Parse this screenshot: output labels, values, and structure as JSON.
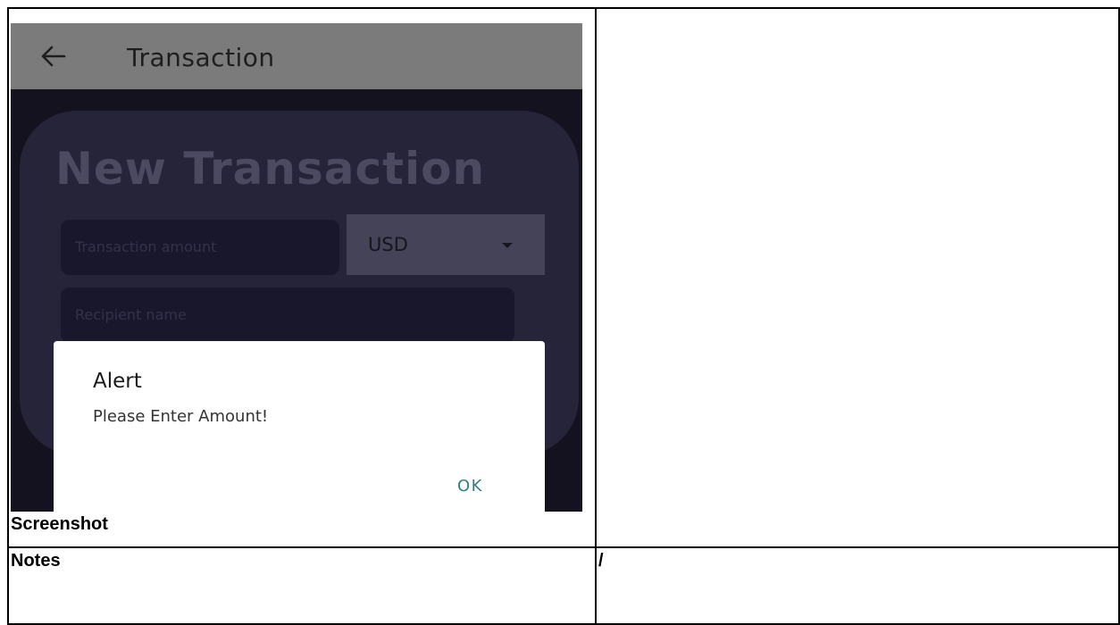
{
  "document": {
    "screenshot_label": "Screenshot",
    "notes_label": "Notes",
    "notes_value": "/"
  },
  "app": {
    "appbar_title": "Transaction",
    "back_icon": "arrow-left-icon",
    "card_title": "New Transaction",
    "amount_placeholder": "Transaction amount",
    "currency_value": "USD",
    "recipient_placeholder": "Recipient name",
    "colors": {
      "appbar": "#7b7b7b",
      "background": "#14121e",
      "card": "#262439",
      "accent_ok": "#2f7e8c"
    }
  },
  "alert": {
    "title": "Alert",
    "message": "Please Enter Amount!",
    "ok_label": "OK"
  }
}
